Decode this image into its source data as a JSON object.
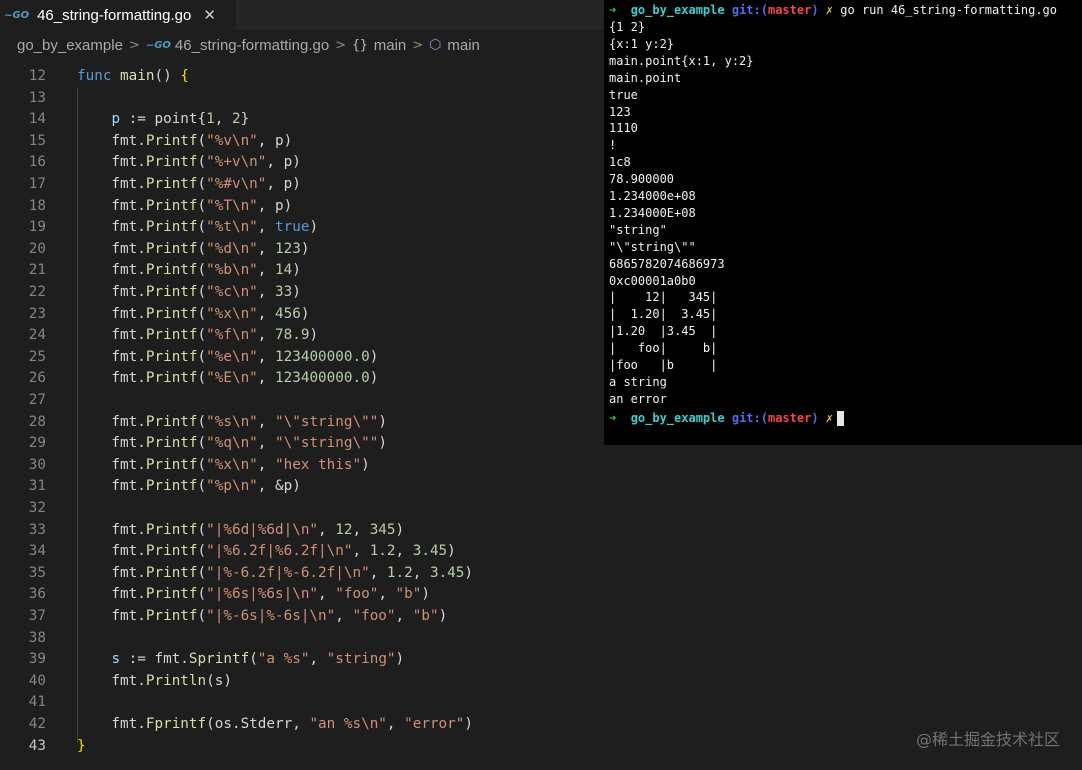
{
  "tab": {
    "icon": "go-file-icon",
    "filename": "46_string-formatting.go",
    "close_glyph": "✕"
  },
  "breadcrumb": {
    "folder": "go_by_example",
    "file": "46_string-formatting.go",
    "namespace": "main",
    "function": "main"
  },
  "editor": {
    "current_line": 43,
    "lines": [
      {
        "n": "12"
      },
      {
        "n": "13"
      },
      {
        "n": "14"
      },
      {
        "n": "15"
      },
      {
        "n": "16"
      },
      {
        "n": "17"
      },
      {
        "n": "18"
      },
      {
        "n": "19"
      },
      {
        "n": "20"
      },
      {
        "n": "21"
      },
      {
        "n": "22"
      },
      {
        "n": "23"
      },
      {
        "n": "24"
      },
      {
        "n": "25"
      },
      {
        "n": "26"
      },
      {
        "n": "27"
      },
      {
        "n": "28"
      },
      {
        "n": "29"
      },
      {
        "n": "30"
      },
      {
        "n": "31"
      },
      {
        "n": "32"
      },
      {
        "n": "33"
      },
      {
        "n": "34"
      },
      {
        "n": "35"
      },
      {
        "n": "36"
      },
      {
        "n": "37"
      },
      {
        "n": "38"
      },
      {
        "n": "39"
      },
      {
        "n": "40"
      },
      {
        "n": "41"
      },
      {
        "n": "42"
      },
      {
        "n": "43"
      }
    ]
  },
  "terminal": {
    "prompt_dir": "go_by_example",
    "prompt_git": "git:(",
    "prompt_branch": "master",
    "prompt_git_close": ")",
    "prompt_dirty": "✗",
    "command": "go run 46_string-formatting.go",
    "output": [
      "{1 2}",
      "{x:1 y:2}",
      "main.point{x:1, y:2}",
      "main.point",
      "true",
      "123",
      "1110",
      "!",
      "1c8",
      "78.900000",
      "1.234000e+08",
      "1.234000E+08",
      "\"string\"",
      "\"\\\"string\\\"\"",
      "6865782074686973",
      "0xc00001a0b0",
      "|    12|   345|",
      "|  1.20|  3.45|",
      "|1.20  |3.45  |",
      "|   foo|     b|",
      "|foo   |b     |",
      "a string",
      "an error"
    ]
  },
  "watermark": "@稀土掘金技术社区"
}
